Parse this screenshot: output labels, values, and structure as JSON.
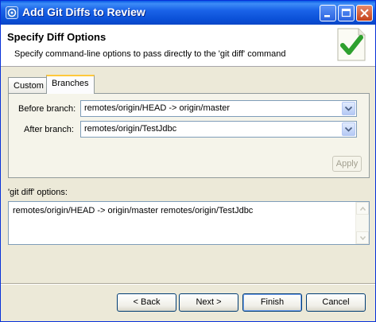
{
  "window": {
    "title": "Add Git Diffs to Review"
  },
  "header": {
    "title": "Specify Diff Options",
    "description": "Specify command-line options to pass directly to the 'git diff' command"
  },
  "tabs": [
    {
      "label": "Custom",
      "selected": false
    },
    {
      "label": "Branches",
      "selected": true
    }
  ],
  "branches": {
    "before_label": "Before branch:",
    "before_value": "remotes/origin/HEAD -> origin/master",
    "after_label": "After branch:",
    "after_value": "remotes/origin/TestJdbc",
    "apply_label": "Apply"
  },
  "options": {
    "label": "'git diff' options:",
    "value": "remotes/origin/HEAD -> origin/master remotes/origin/TestJdbc"
  },
  "footer": {
    "back_label": "< Back",
    "next_label": "Next >",
    "finish_label": "Finish",
    "cancel_label": "Cancel"
  },
  "colors": {
    "titlebar": "#0a5be5",
    "tab_highlight": "#ffc83c",
    "check_green": "#2ea02e"
  }
}
